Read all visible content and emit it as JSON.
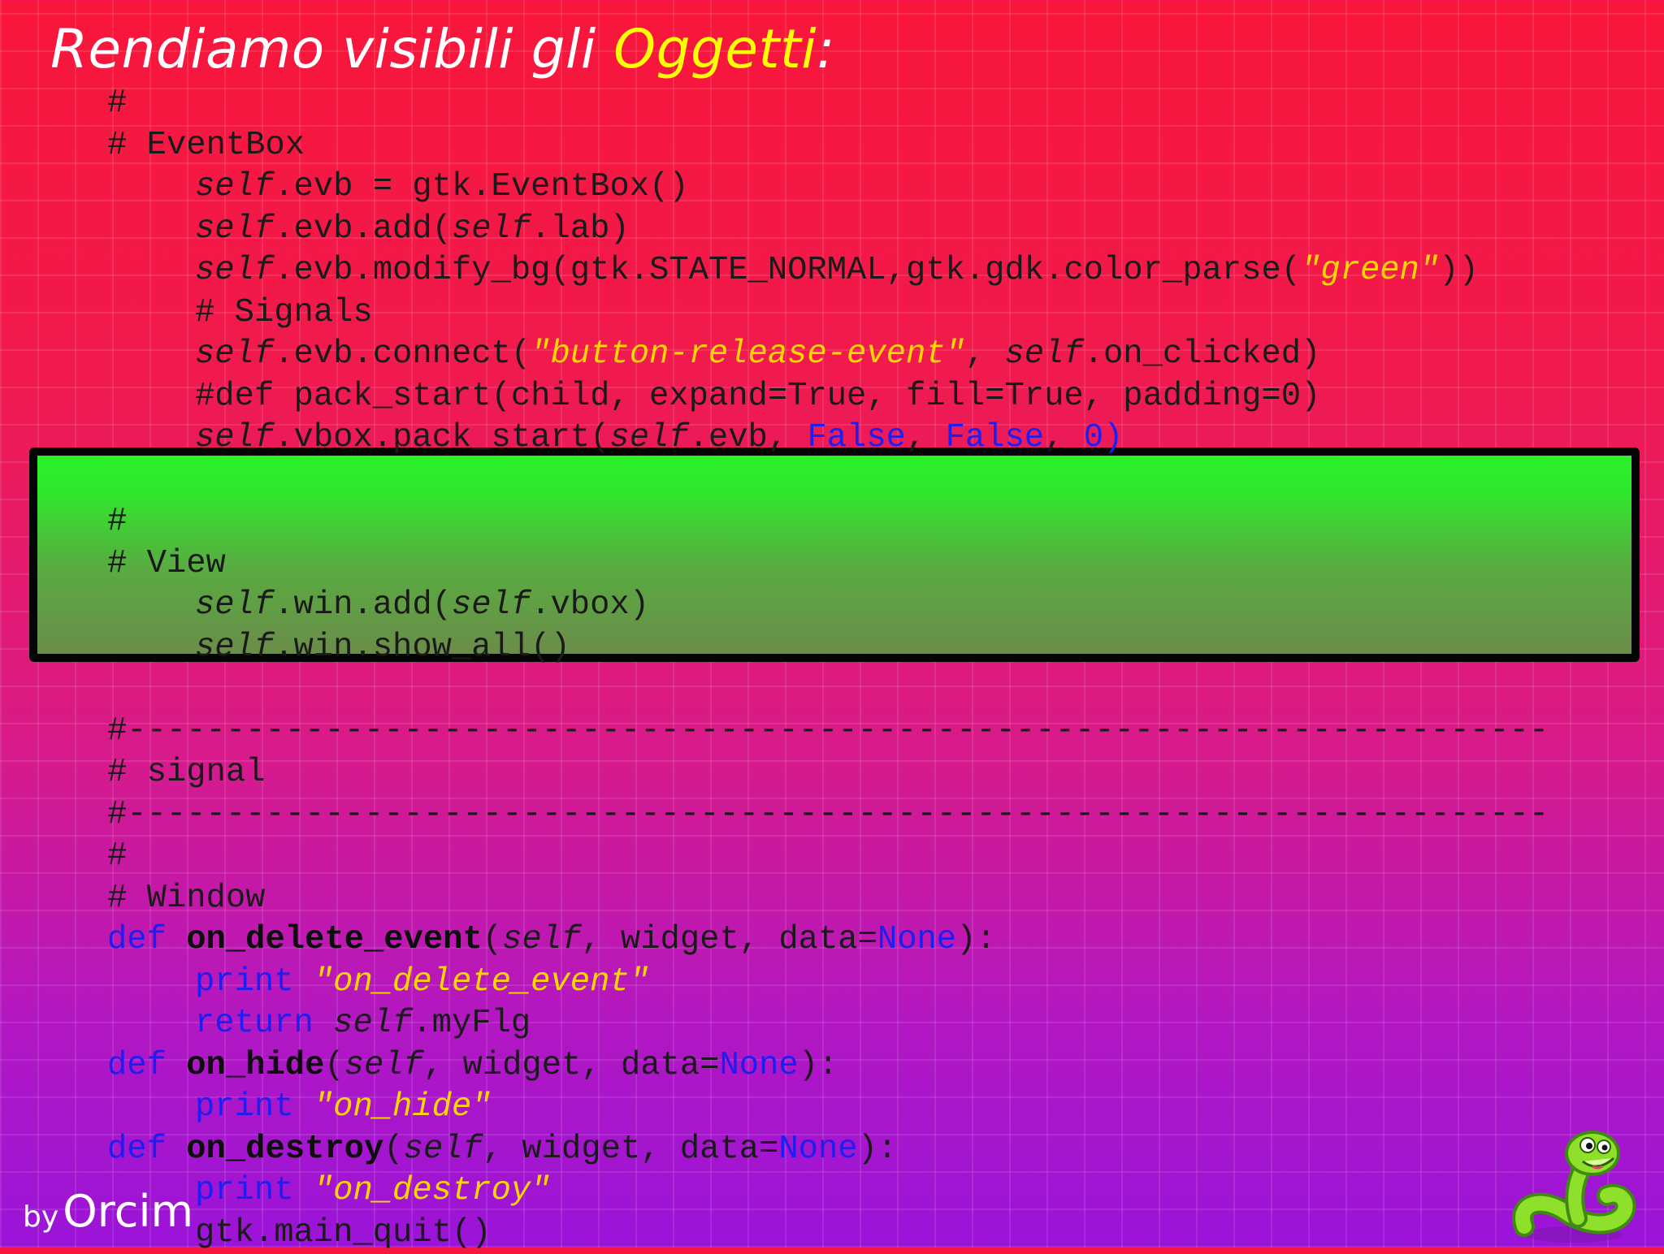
{
  "slide": {
    "title_main": "Rendiamo visibili gli ",
    "title_accent": "Oggetti",
    "title_end": ":",
    "author_by": "by",
    "author_name": "Orcim"
  },
  "code": {
    "l1": "#",
    "l2": "# EventBox",
    "l3_self": "self",
    "l3_a": ".evb = gtk.EventBox()",
    "l4_self": "self",
    "l4_a": ".evb.add(",
    "l4_self2": "self",
    "l4_b": ".lab)",
    "l5_self": "self",
    "l5_a": ".evb.modify_bg(gtk.STATE_NORMAL,gtk.gdk.color_parse(",
    "l5_str": "\"green\"",
    "l5_b": "))",
    "l6": "# Signals",
    "l7_self": "self",
    "l7_a": ".evb.connect(",
    "l7_str": "\"button-release-event\"",
    "l7_b": ", ",
    "l7_self2": "self",
    "l7_c": ".on_clicked)",
    "l8": "#def pack_start(child, expand=True, fill=True, padding=0)",
    "l9_self": "self",
    "l9_a": ".vbox.pack_start(",
    "l9_self2": "self",
    "l9_b": ".evb, ",
    "l9_kw1": "False",
    "l9_c": ", ",
    "l9_kw2": "False",
    "l9_d": ", ",
    "l9_e": "0)",
    "l11": "#",
    "l12": "# View",
    "l13_self": "self",
    "l13_a": ".win.add(",
    "l13_self2": "self",
    "l13_b": ".vbox)",
    "l14_self": "self",
    "l14_a": ".win.show_all()",
    "l16": "#------------------------------------------------------------------------",
    "l17": "# signal",
    "l18": "#------------------------------------------------------------------------",
    "l19": "#",
    "l20": "# Window",
    "l21_def": "def",
    "l21_sp": " ",
    "l21_fn": "on_delete_event",
    "l21_a": "(",
    "l21_self": "self",
    "l21_b": ", widget, data=",
    "l21_none": "None",
    "l21_c": "):",
    "l22_print": "print",
    "l22_sp": " ",
    "l22_str": "\"on_delete_event\"",
    "l23_return": "return",
    "l23_sp": " ",
    "l23_self": "self",
    "l23_a": ".myFlg",
    "l24_def": "def",
    "l24_sp": " ",
    "l24_fn": "on_hide",
    "l24_a": "(",
    "l24_self": "self",
    "l24_b": ", widget, data=",
    "l24_none": "None",
    "l24_c": "):",
    "l25_print": "print",
    "l25_sp": " ",
    "l25_str": "\"on_hide\"",
    "l26_def": "def",
    "l26_sp": " ",
    "l26_fn": "on_destroy",
    "l26_a": "(",
    "l26_self": "self",
    "l26_b": ", widget, data=",
    "l26_none": "None",
    "l26_c": "):",
    "l27_print": "print",
    "l27_sp": " ",
    "l27_str": "\"on_destroy\"",
    "l28": "gtk.main_quit()"
  },
  "colors": {
    "background_top": "#f8163a",
    "background_bottom": "#9a14d8",
    "title_accent": "#ffff00",
    "string": "#ffd700",
    "keyword": "#1e1ef0",
    "green_box": "#2af22a"
  },
  "icons": {
    "mascot": "snake-mascot-icon"
  }
}
